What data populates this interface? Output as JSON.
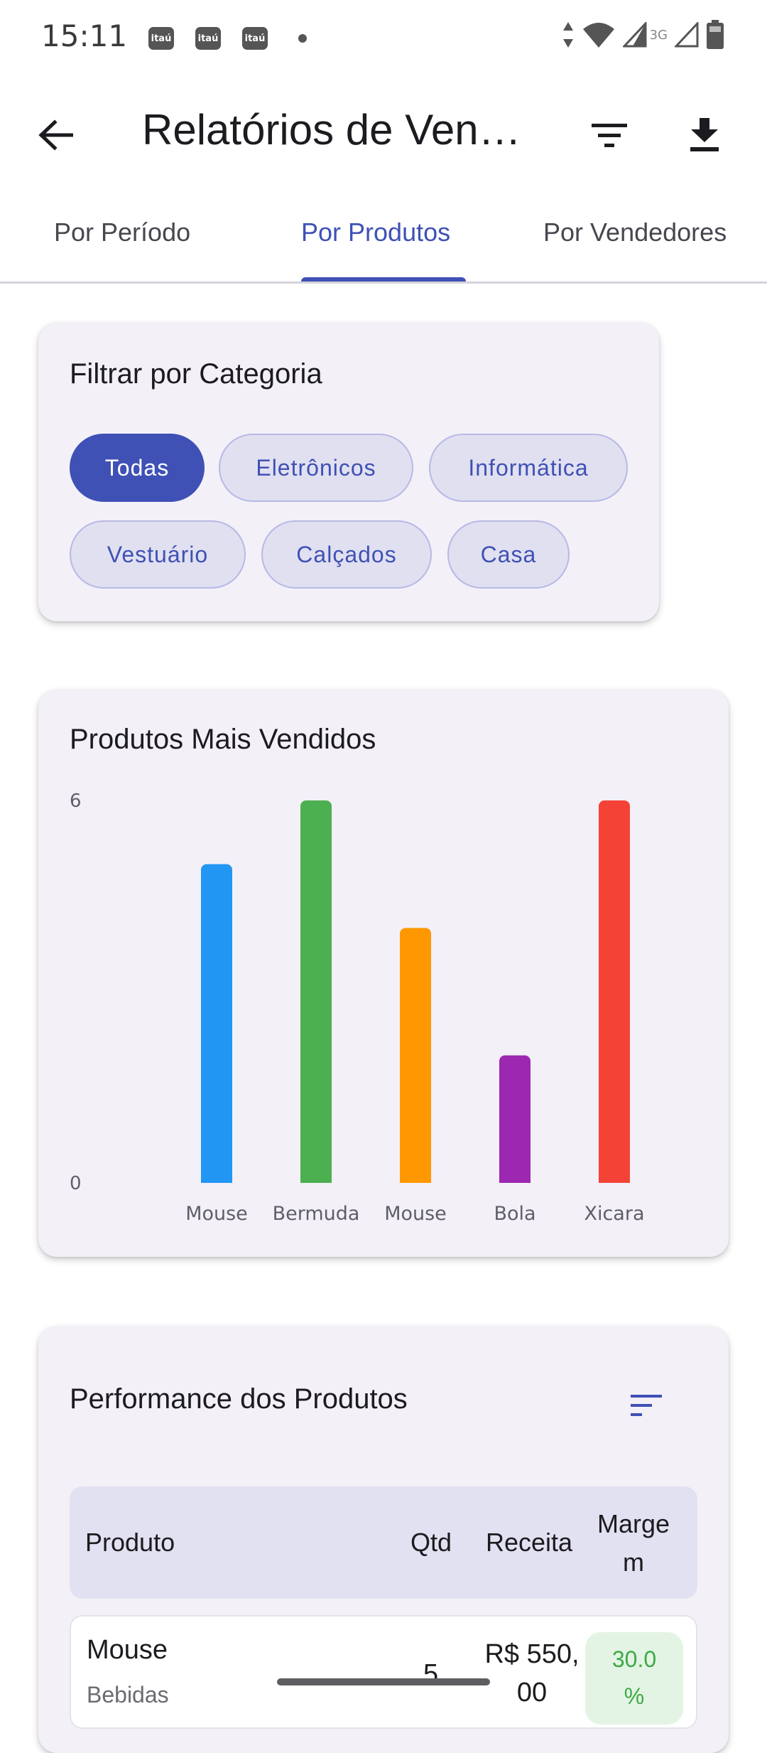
{
  "status_bar": {
    "time": "15:11",
    "notification_icons": [
      "itaú",
      "itaú",
      "itaú"
    ],
    "network_label": "3G",
    "icons": [
      "data-arrows-icon",
      "wifi-icon",
      "signal-icon",
      "signal-icon",
      "battery-icon"
    ]
  },
  "app_bar": {
    "title": "Relatórios de Ven…",
    "back_icon": "arrow-back-icon",
    "filter_icon": "filter-icon",
    "download_icon": "download-icon"
  },
  "tabs": [
    {
      "label": "Por Período",
      "active": false
    },
    {
      "label": "Por Produtos",
      "active": true
    },
    {
      "label": "Por Vendedores",
      "active": false
    }
  ],
  "filter_card": {
    "title": "Filtrar por Categoria",
    "chips": [
      {
        "label": "Todas",
        "selected": true
      },
      {
        "label": "Eletrônicos",
        "selected": false
      },
      {
        "label": "Informática",
        "selected": false
      },
      {
        "label": "Vestuário",
        "selected": false
      },
      {
        "label": "Calçados",
        "selected": false
      },
      {
        "label": "Casa",
        "selected": false
      }
    ]
  },
  "chart_card": {
    "title": "Produtos Mais Vendidos"
  },
  "chart_data": {
    "type": "bar",
    "title": "Produtos Mais Vendidos",
    "categories": [
      "Mouse",
      "Bermuda",
      "Mouse",
      "Bola",
      "Xicara"
    ],
    "values": [
      5,
      6,
      4,
      2,
      6
    ],
    "colors": [
      "#2196f3",
      "#4caf50",
      "#ff9800",
      "#9c27b0",
      "#f44336"
    ],
    "ylim": [
      0,
      6
    ],
    "y_tick_labels": [
      "0",
      "6"
    ],
    "grid": false,
    "xlabel": "",
    "ylabel": ""
  },
  "performance_card": {
    "title": "Performance dos Produtos",
    "sort_icon": "sort-icon",
    "columns": [
      "Produto",
      "Qtd",
      "Receita",
      "Marge\nm"
    ],
    "rows": [
      {
        "product": "Mouse",
        "category": "Bebidas",
        "qty": "5",
        "revenue": "R$ 550,\n00",
        "margin": "30.0\n%"
      }
    ]
  },
  "colors": {
    "primary": "#3f51b5",
    "card_background": "#f3f0f8",
    "margin_positive": "#3daa46"
  }
}
